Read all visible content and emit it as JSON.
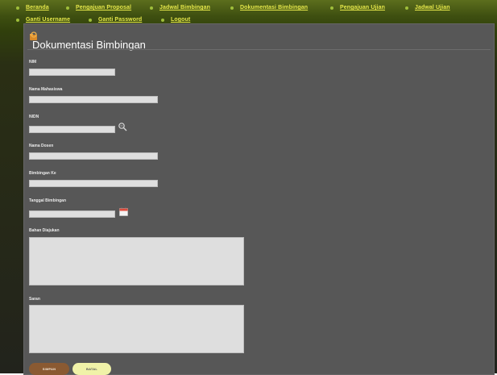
{
  "nav": {
    "items": [
      {
        "label": "Beranda"
      },
      {
        "label": "Pengajuan Proposal"
      },
      {
        "label": "Jadwal Bimbingan"
      },
      {
        "label": "Dokumentasi Bimbingan"
      },
      {
        "label": "Pengajuan Ujian"
      },
      {
        "label": "Jadwal Ujian"
      },
      {
        "label": "Ganti Username"
      },
      {
        "label": "Ganti Password"
      },
      {
        "label": "Logout"
      }
    ]
  },
  "page": {
    "title": "Dokumentasi Bimbingan",
    "title_icon": "folder-icon"
  },
  "form": {
    "nim": {
      "label": "NIM",
      "value": ""
    },
    "nama_mahasiswa": {
      "label": "Nama Mahasiswa",
      "value": ""
    },
    "nidn": {
      "label": "NIDN",
      "value": "",
      "lookup_icon": "search-icon"
    },
    "nama_dosen": {
      "label": "Nama Dosen",
      "value": ""
    },
    "bimbingan_ke": {
      "label": "Bimbingan Ke",
      "value": ""
    },
    "tanggal": {
      "label": "Tanggal Bimbingan",
      "value": "",
      "picker_icon": "calendar-icon"
    },
    "bahan": {
      "label": "Bahan Diajukan",
      "value": ""
    },
    "saran": {
      "label": "Saran",
      "value": ""
    }
  },
  "buttons": {
    "save": "SIMPAN",
    "cancel": "BATAL"
  },
  "colors": {
    "nav_link": "#e6e84a",
    "panel": "#575757",
    "save_button": "#8a5a32",
    "cancel_button": "#f0f2a8"
  }
}
